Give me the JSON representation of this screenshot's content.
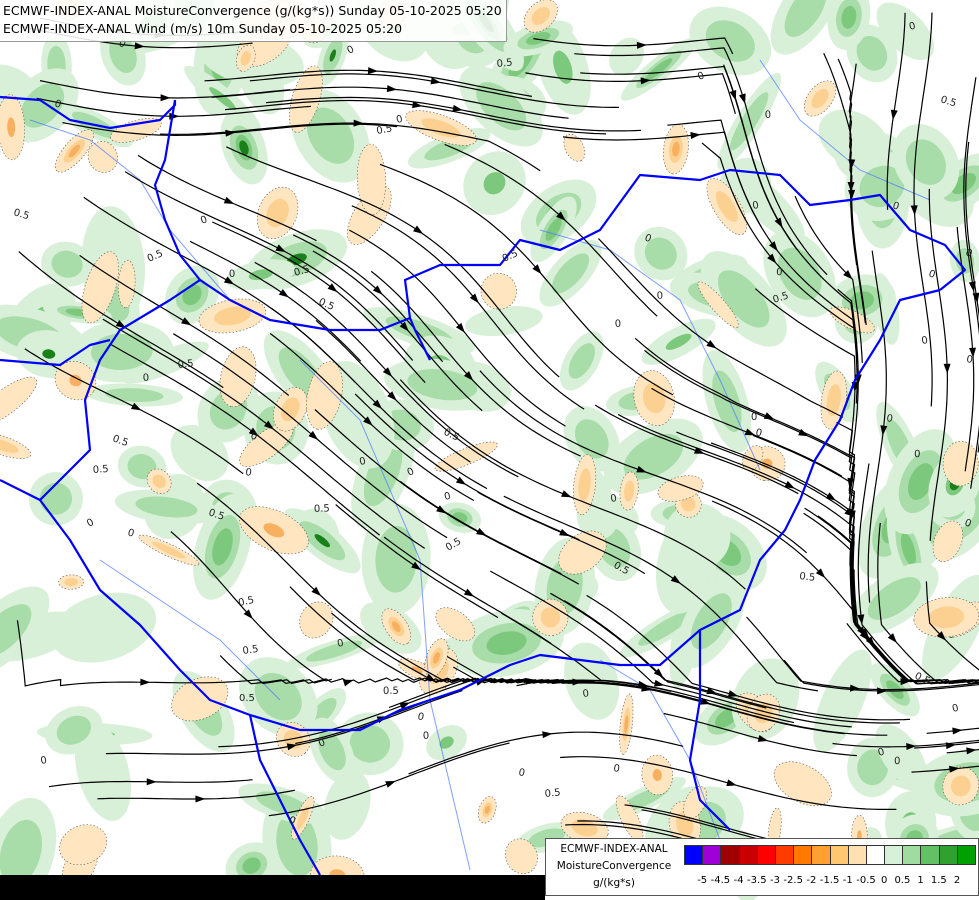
{
  "title": {
    "line1": "ECMWF-INDEX-ANAL MoistureConvergence (g/(kg*s)) Sunday 05-10-2025 05:20",
    "line2": "ECMWF-INDEX-ANAL Wind (m/s) 10m Sunday 05-10-2025 05:20"
  },
  "map": {
    "contour_labels": [
      "0",
      "0.5"
    ],
    "border_color": "#0000ff",
    "river_color": "#4a78ff",
    "streamline_color": "#000000"
  },
  "legend": {
    "model": "ECMWF-INDEX-ANAL",
    "variable": "MoistureConvergence",
    "unit": "g/(kg*s)",
    "ticks": [
      "-5",
      "-4.5",
      "-4",
      "-3.5",
      "-3",
      "-2.5",
      "-2",
      "-1.5",
      "-1",
      "-0.5",
      "0",
      "0.5",
      "1",
      "1.5",
      "2"
    ],
    "colors": [
      "#0000ff",
      "#a000d8",
      "#a00000",
      "#c80000",
      "#ff0000",
      "#ff3c00",
      "#ff7800",
      "#ffa030",
      "#ffc870",
      "#ffe0b0",
      "#ffffff",
      "#d8f0d8",
      "#a0dca0",
      "#64c064",
      "#30a030",
      "#00a000"
    ]
  }
}
